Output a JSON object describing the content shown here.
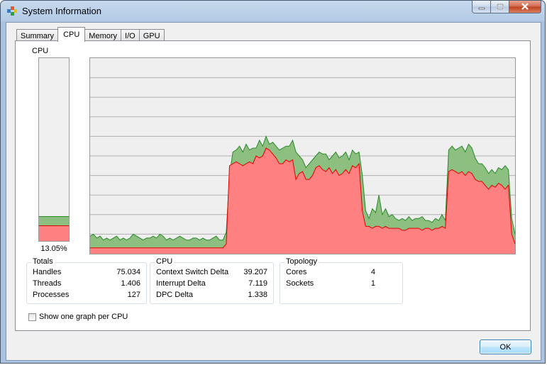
{
  "window": {
    "title": "System Information"
  },
  "tabs": [
    {
      "label": "Summary",
      "active": false
    },
    {
      "label": "CPU",
      "active": true
    },
    {
      "label": "Memory",
      "active": false
    },
    {
      "label": "I/O",
      "active": false
    },
    {
      "label": "GPU",
      "active": false
    }
  ],
  "cpu_meter": {
    "label": "CPU",
    "percent_text": "13.05%",
    "total_fraction": 0.13,
    "kernel_fraction": 0.08
  },
  "colors": {
    "user_fill": "#8cbf80",
    "user_line": "#2a8a2a",
    "kernel_fill": "#ff8080",
    "kernel_line": "#e00000",
    "grid": "#b0b0b0"
  },
  "groups": {
    "totals": {
      "title": "Totals",
      "rows": [
        {
          "label": "Handles",
          "value": "75.034"
        },
        {
          "label": "Threads",
          "value": "1.406"
        },
        {
          "label": "Processes",
          "value": "127"
        }
      ]
    },
    "cpu": {
      "title": "CPU",
      "rows": [
        {
          "label": "Context Switch Delta",
          "value": "39.207"
        },
        {
          "label": "Interrupt Delta",
          "value": "7.119"
        },
        {
          "label": "DPC Delta",
          "value": "1.338"
        }
      ]
    },
    "topology": {
      "title": "Topology",
      "rows": [
        {
          "label": "Cores",
          "value": "4"
        },
        {
          "label": "Sockets",
          "value": "1"
        }
      ]
    }
  },
  "checkbox": {
    "label": "Show one graph per CPU",
    "checked": false
  },
  "buttons": {
    "ok": "OK"
  },
  "chart_data": {
    "type": "area",
    "series": [
      {
        "name": "total",
        "values": [
          9,
          10,
          8,
          9,
          7,
          8,
          7,
          8,
          9,
          7,
          8,
          7,
          8,
          10,
          9,
          8,
          7,
          8,
          8,
          9,
          8,
          10,
          9,
          7,
          8,
          7,
          8,
          9,
          8,
          7,
          7,
          8,
          8,
          7,
          8,
          7,
          7,
          8,
          9,
          7,
          7,
          11,
          40,
          52,
          53,
          55,
          52,
          56,
          53,
          54,
          54,
          58,
          55,
          60,
          56,
          57,
          55,
          53,
          54,
          55,
          55,
          58,
          52,
          50,
          48,
          44,
          46,
          48,
          50,
          52,
          51,
          51,
          48,
          50,
          52,
          49,
          50,
          52,
          48,
          53,
          51,
          52,
          40,
          22,
          18,
          23,
          21,
          30,
          20,
          23,
          19,
          20,
          18,
          17,
          18,
          17,
          19,
          17,
          18,
          18,
          19,
          17,
          17,
          16,
          18,
          17,
          20,
          17,
          53,
          55,
          53,
          54,
          55,
          52,
          56,
          54,
          49,
          46,
          46,
          44,
          41,
          43,
          41,
          44,
          43,
          45,
          43,
          18,
          10
        ]
      },
      {
        "name": "kernel",
        "values": [
          3,
          3,
          3,
          3,
          3,
          3,
          3,
          3,
          3,
          3,
          3,
          3,
          3,
          3,
          3,
          3,
          3,
          3,
          3,
          3,
          3,
          3,
          3,
          3,
          3,
          3,
          3,
          3,
          3,
          3,
          3,
          3,
          3,
          3,
          3,
          3,
          3,
          3,
          3,
          3,
          3,
          5,
          45,
          46,
          47,
          46,
          45,
          46,
          47,
          46,
          50,
          49,
          50,
          54,
          53,
          51,
          49,
          46,
          46,
          48,
          47,
          48,
          38,
          41,
          42,
          38,
          38,
          40,
          44,
          45,
          43,
          42,
          44,
          41,
          43,
          40,
          41,
          43,
          41,
          45,
          44,
          46,
          22,
          14,
          14,
          13,
          14,
          14,
          13,
          14,
          13,
          13,
          13,
          13,
          12,
          12,
          13,
          13,
          13,
          13,
          12,
          13,
          13,
          12,
          13,
          13,
          14,
          13,
          42,
          43,
          42,
          41,
          42,
          40,
          42,
          41,
          38,
          37,
          37,
          35,
          33,
          35,
          34,
          36,
          35,
          33,
          35,
          10,
          5
        ]
      }
    ],
    "ylim": [
      0,
      100
    ],
    "grid": true
  }
}
